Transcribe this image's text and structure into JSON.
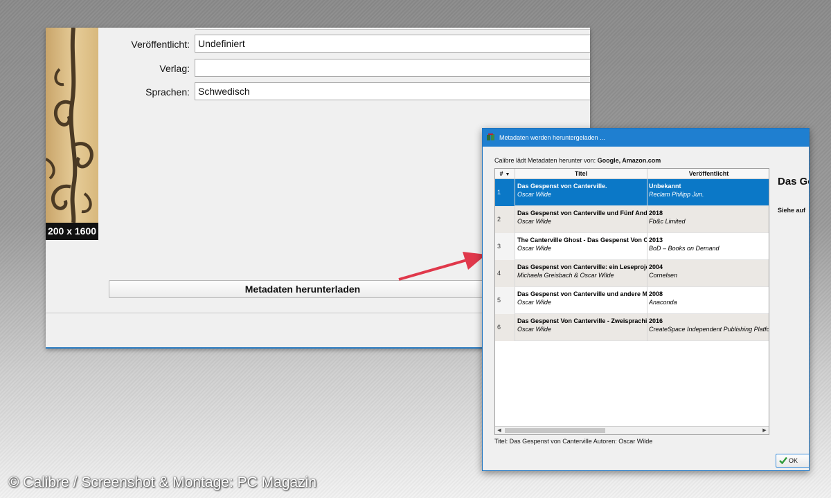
{
  "editor": {
    "cover_size": "200 x 1600",
    "fields": [
      {
        "label": "Veröffentlicht:",
        "value": "Undefiniert"
      },
      {
        "label": "Verlag:",
        "value": ""
      },
      {
        "label": "Sprachen:",
        "value": "Schwedisch"
      }
    ],
    "download_button": "Metadaten herunterladen"
  },
  "dialog": {
    "title": "Metadaten werden heruntergeladen ...",
    "source_prefix": "Calibre lädt Metadaten herunter von:",
    "sources": "Google, Amazon.com",
    "columns": {
      "num": "#",
      "title": "Titel",
      "published": "Veröffentlicht"
    },
    "rows": [
      {
        "num": "1",
        "title": "Das Gespenst von Canterville.",
        "author": "Oscar Wilde",
        "year": "Unbekannt",
        "publisher": "Reclam Philipp Jun."
      },
      {
        "num": "2",
        "title": "Das Gespenst von Canterville und Fünf Andere Erzählungen",
        "author": "Oscar Wilde",
        "year": "2018",
        "publisher": "Fb&c Limited"
      },
      {
        "num": "3",
        "title": "The Canterville Ghost - Das Gespenst Von Canterville",
        "author": "Oscar Wilde",
        "year": "2013",
        "publisher": "BoD – Books on Demand"
      },
      {
        "num": "4",
        "title": "Das Gespenst von Canterville: ein Leseprojekt",
        "author": "Michaela Greisbach & Oscar Wilde",
        "year": "2004",
        "publisher": "Cornelsen"
      },
      {
        "num": "5",
        "title": "Das Gespenst von Canterville und andere Märchen",
        "author": "Oscar Wilde",
        "year": "2008",
        "publisher": "Anaconda"
      },
      {
        "num": "6",
        "title": "Das Gespenst Von Canterville - Zweisprachige Ausgabe",
        "author": "Oscar Wilde",
        "year": "2016",
        "publisher": "CreateSpace Independent Publishing Platform"
      }
    ],
    "side_title": "Das Ge",
    "side_sub": "Siehe auf",
    "status": "Titel: Das Gespenst von Canterville Autoren: Oscar Wilde",
    "ok_label": "OK"
  },
  "credit": "© Calibre / Screenshot & Montage: PC Magazin",
  "colors": {
    "accent": "#1f7fd0",
    "selection": "#0b78c7",
    "arrow": "#e0384b"
  },
  "icons": [
    "app-icon",
    "sort-arrow-icon",
    "scroll-left-icon",
    "scroll-right-icon",
    "check-icon"
  ]
}
